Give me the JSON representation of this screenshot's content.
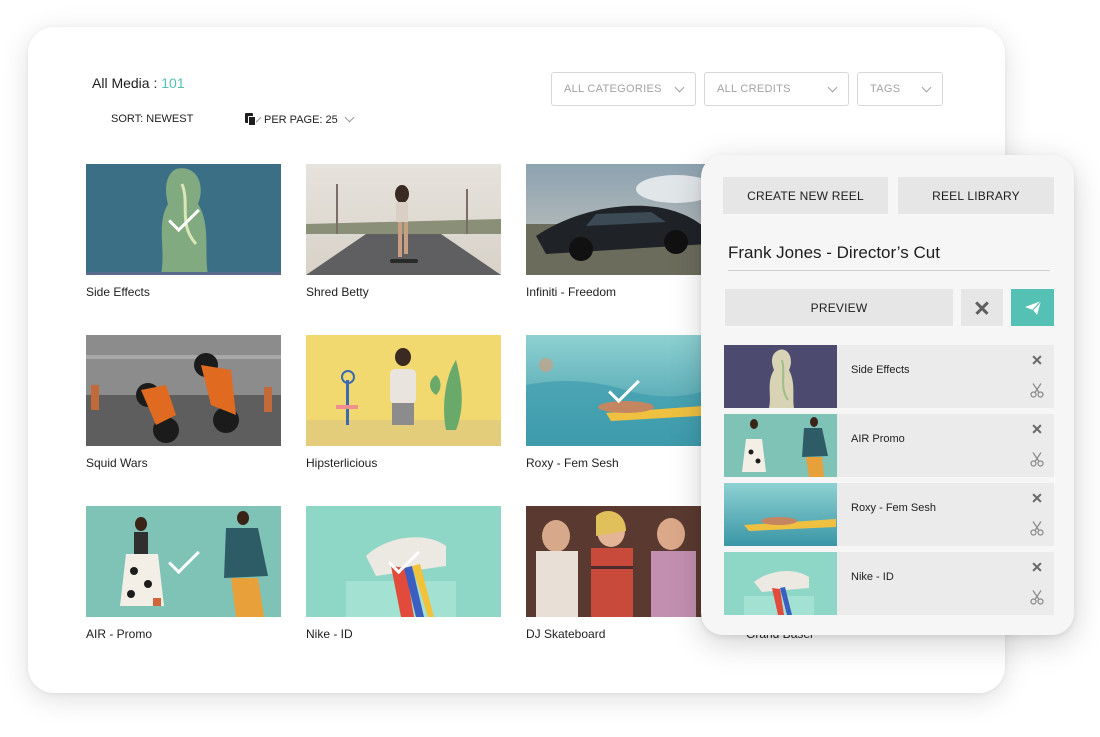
{
  "header": {
    "all_media_label": "All Media :",
    "all_media_count": "101",
    "sort_label": "SORT: NEWEST",
    "per_page_label": "PER PAGE: 25"
  },
  "filters": [
    {
      "label": "ALL CATEGORIES"
    },
    {
      "label": "ALL CREDITS"
    },
    {
      "label": "TAGS"
    }
  ],
  "media": [
    {
      "title": "Side Effects",
      "selected": true
    },
    {
      "title": "Shred Betty",
      "selected": false
    },
    {
      "title": "Infiniti - Freedom",
      "selected": false
    },
    {
      "title": "",
      "selected": false
    },
    {
      "title": "Squid Wars",
      "selected": false
    },
    {
      "title": "Hipsterlicious",
      "selected": false
    },
    {
      "title": "Roxy - Fem Sesh",
      "selected": true
    },
    {
      "title": "",
      "selected": false
    },
    {
      "title": "AIR - Promo",
      "selected": true
    },
    {
      "title": "Nike - ID",
      "selected": true
    },
    {
      "title": "DJ Skateboard",
      "selected": false
    },
    {
      "title": "Grand Basel",
      "selected": false
    }
  ],
  "reel": {
    "create_new_label": "CREATE NEW REEL",
    "library_label": "REEL LIBRARY",
    "name": "Frank Jones - Director’s Cut",
    "preview_label": "PREVIEW",
    "items": [
      {
        "title": "Side Effects"
      },
      {
        "title": "AIR Promo"
      },
      {
        "title": "Roxy - Fem Sesh"
      },
      {
        "title": "Nike - ID"
      }
    ]
  },
  "colors": {
    "accent": "#55c1b4",
    "panel_bg": "#f6f6f6",
    "button_bg": "#e6e6e6"
  },
  "icons": [
    "copy-icon",
    "chevron-down-icon",
    "close-icon",
    "send-icon",
    "scissors-icon",
    "checkmark-icon"
  ]
}
